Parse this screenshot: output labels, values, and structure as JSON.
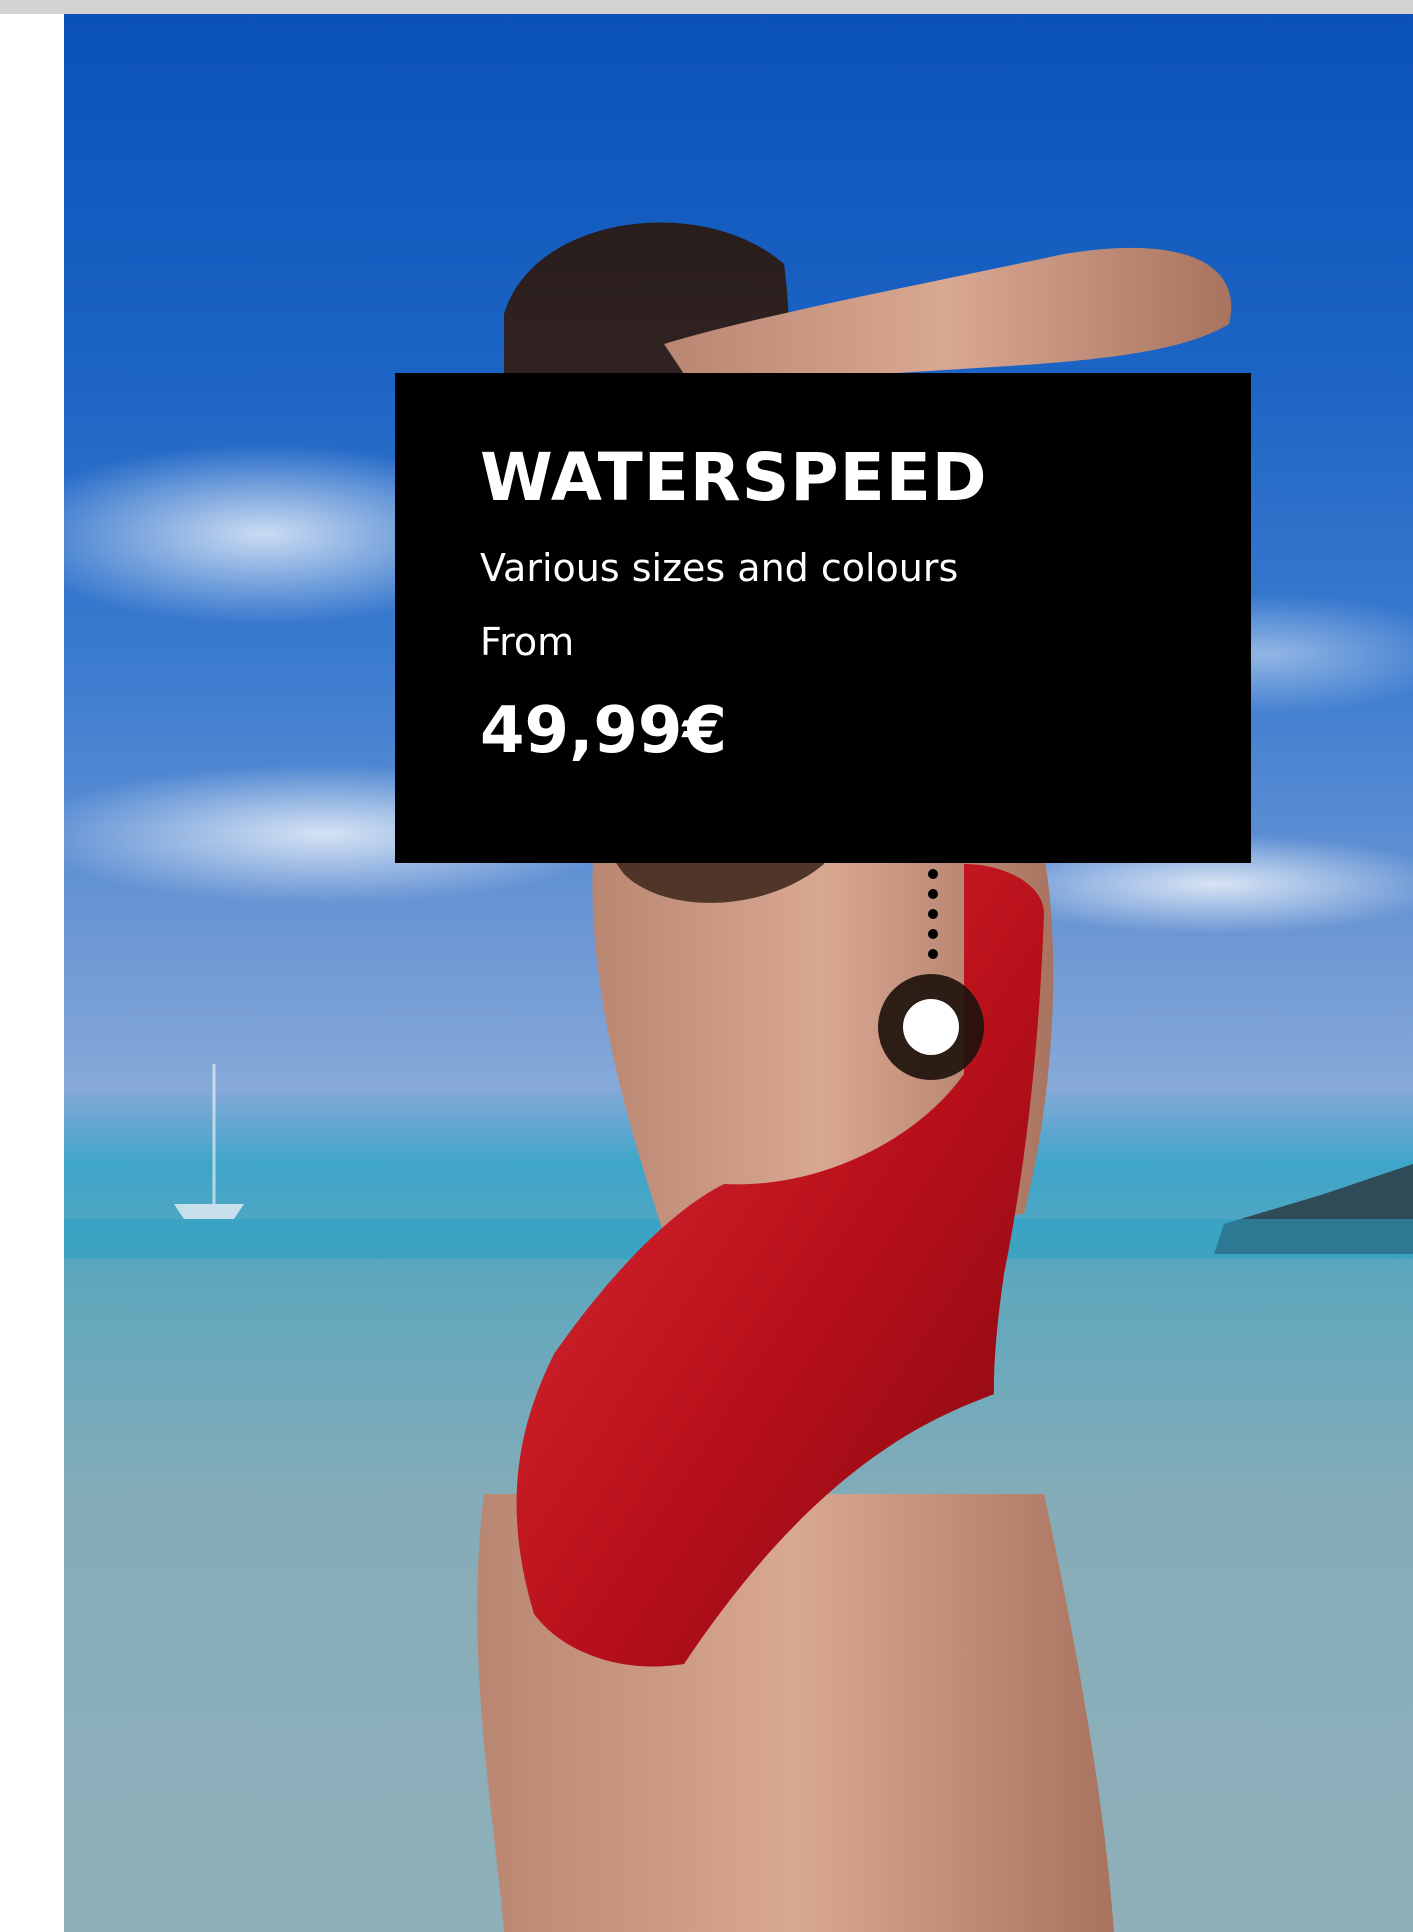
{
  "product": {
    "name": "WATERSPEED",
    "description": "Various sizes and colours",
    "price_prefix": "From",
    "price": "49,99€"
  },
  "colors": {
    "card_background": "#000000",
    "card_text": "#ffffff",
    "swimsuit": "#c0141c",
    "sky": "#1b63c4",
    "sea": "#5fa7bd"
  },
  "icons": {
    "hotspot": "hotspot-marker-icon"
  }
}
